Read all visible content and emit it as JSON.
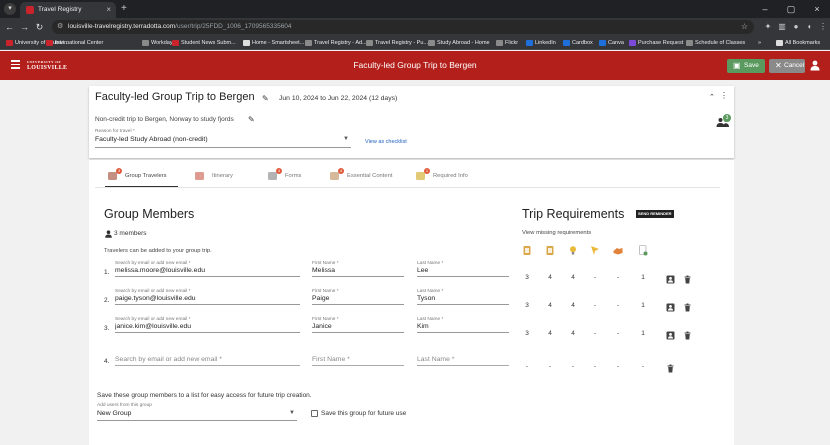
{
  "browser": {
    "tab_title": "Travel Registry",
    "url_host": "louisville-travelregistry.terradotta.com",
    "url_path": "/user/trip/25FDD_1006_1709565335604",
    "bookmarks": [
      {
        "label": "University of Louisvi...",
        "icon": "ul"
      },
      {
        "label": "International Center",
        "icon": "ul"
      },
      {
        "label": "Workday",
        "icon": "gray"
      },
      {
        "label": "Student News Subm...",
        "icon": "ul"
      },
      {
        "label": "Home - Smartsheet...",
        "icon": "white"
      },
      {
        "label": "Travel Registry - Ad...",
        "icon": "gray"
      },
      {
        "label": "Travel Registry - Pu...",
        "icon": "gray"
      },
      {
        "label": "Study Abroad - Home",
        "icon": "gray"
      },
      {
        "label": "Flickr",
        "icon": "gray"
      },
      {
        "label": "LinkedIn",
        "icon": "blue"
      },
      {
        "label": "Cardbox",
        "icon": "blue"
      },
      {
        "label": "Canva",
        "icon": "blue"
      },
      {
        "label": "Purchase Request",
        "icon": "purple"
      },
      {
        "label": "Schedule of Classes",
        "icon": "gray"
      }
    ],
    "all_bookmarks": "All Bookmarks"
  },
  "header": {
    "logo_main": "LOUISVILLE",
    "logo_top": "UNIVERSITY OF",
    "title": "Faculty-led Group Trip to Bergen",
    "save_label": "Save",
    "cancel_label": "Cancel"
  },
  "trip": {
    "title": "Faculty-led Group Trip to Bergen",
    "dates": "Jun 10, 2024 to Jun 22, 2024  (12 days)",
    "description": "Non-credit trip to Bergen, Norway to study fjords",
    "reason_label": "Reason for travel *",
    "reason_value": "Faculty-led Study Abroad (non-credit)",
    "checklist_link": "View as checklist",
    "group_badge": "3"
  },
  "tabs": [
    {
      "label": "Group Travelers",
      "badge": "3",
      "active": true
    },
    {
      "label": "Itinerary",
      "badge": "",
      "active": false
    },
    {
      "label": "Forms",
      "badge": "4",
      "active": false
    },
    {
      "label": "Essential Content",
      "badge": "4",
      "active": false
    },
    {
      "label": "Required Info",
      "badge": "1",
      "active": false
    }
  ],
  "group": {
    "title": "Group Members",
    "count_label": "3 members",
    "helper": "Travelers can be added to your group trip.",
    "email_label": "Search by email or add new email *",
    "first_label": "First Name *",
    "last_label": "Last Name *",
    "members": [
      {
        "num": "1.",
        "email": "melissa.moore@louisville.edu",
        "first": "Melissa",
        "last": "Lee"
      },
      {
        "num": "2.",
        "email": "paige.tyson@louisville.edu",
        "first": "Paige",
        "last": "Tyson"
      },
      {
        "num": "3.",
        "email": "janice.kim@louisville.edu",
        "first": "Janice",
        "last": "Kim"
      }
    ],
    "new_row": {
      "num": "4.",
      "email_ph": "Search by email or add new email *",
      "first_ph": "First Name *",
      "last_ph": "Last Name *"
    },
    "save_prompt": "Save these group members to a list for easy access for future trip creation.",
    "add_from_label": "Add users from this group",
    "group_select": "New Group",
    "save_future": "Save this group for future use"
  },
  "requirements": {
    "title": "Trip Requirements",
    "send_reminder": "SEND REMINDER",
    "view_missing": "View missing requirements",
    "icons": [
      "clipboard-icon",
      "notebook-icon",
      "lightbulb-icon",
      "flag-icon",
      "handshake-icon",
      "document-check-icon"
    ],
    "icon_colors": [
      "#d9a84a",
      "#d9a84a",
      "#e8b93a",
      "#e8b93a",
      "#e0823a",
      "#9aa36a"
    ],
    "rows": [
      [
        "3",
        "4",
        "4",
        "-",
        "-",
        "1"
      ],
      [
        "3",
        "4",
        "4",
        "-",
        "-",
        "1"
      ],
      [
        "3",
        "4",
        "4",
        "-",
        "-",
        "1"
      ],
      [
        "-",
        "-",
        "-",
        "-",
        "-",
        "-"
      ]
    ]
  }
}
